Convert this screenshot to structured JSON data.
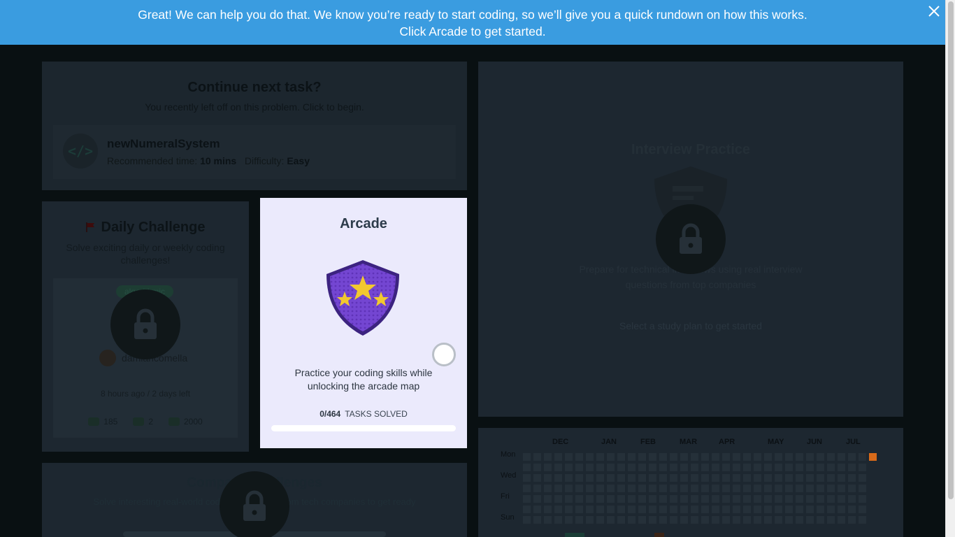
{
  "banner": {
    "line1": "Great! We can help you do that. We know you’re ready to start coding, so we’ll give you a quick rundown on how this works.",
    "line2": "Click Arcade to get started.",
    "close_icon": "close-icon"
  },
  "continue_task": {
    "title": "Continue next task?",
    "subtitle": "You recently left off on this problem. Click to begin.",
    "task_icon": "</>",
    "task_name": "newNumeralSystem",
    "time_label": "Recommended time:",
    "time_value": "10 mins",
    "difficulty_label": "Difficulty:",
    "difficulty_value": "Easy"
  },
  "daily_challenge": {
    "title": "Daily Challenge",
    "subtitle": "Solve exciting daily or weekly coding challenges!",
    "tag": "algorithmic",
    "author": "damiancomella",
    "time": "8 hours ago / 2 days left",
    "stats": {
      "participants": "185",
      "likes": "2",
      "points": "2000"
    }
  },
  "arcade": {
    "title": "Arcade",
    "description": "Practice your coding skills while unlocking the arcade map",
    "solved_count": "0/464",
    "solved_label": "TASKS SOLVED",
    "progress": 0,
    "colors": {
      "shield": "#6a3fc8",
      "star": "#f2c82f",
      "progress": "#7a4cd0"
    }
  },
  "companies": {
    "title": "Company Challenges",
    "subtitle": "Solve interesting real-world coding challenges from tech companies to get ready"
  },
  "interview": {
    "title": "Interview Practice",
    "description": "Prepare for technical interviews using real interview questions from top companies",
    "hint": "Select a study plan to get started"
  },
  "heatmap": {
    "months": [
      "DEC",
      "JAN",
      "FEB",
      "MAR",
      "APR",
      "MAY",
      "JUN",
      "JUL"
    ],
    "days": [
      "Mon",
      "Wed",
      "Fri",
      "Sun"
    ],
    "weeks": 33,
    "active_color": "#d86a19"
  }
}
